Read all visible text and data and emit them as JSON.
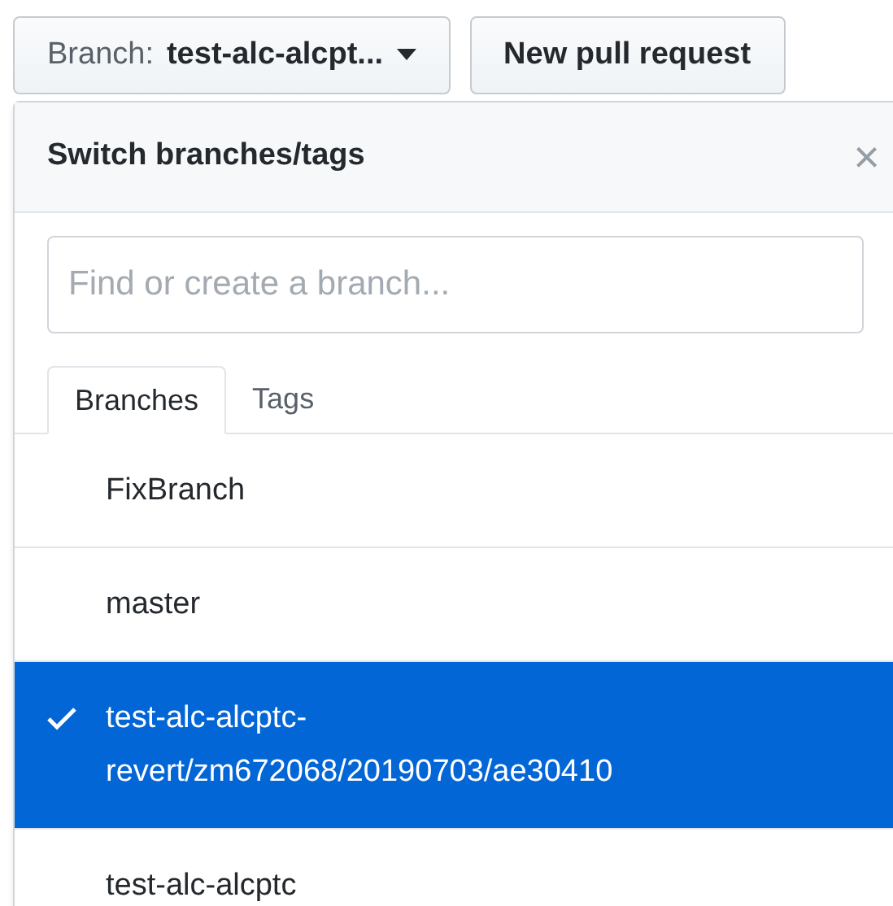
{
  "branch_button": {
    "prefix": "Branch:",
    "value": "test-alc-alcpt..."
  },
  "pull_request_button": {
    "label": "New pull request"
  },
  "dropdown": {
    "title": "Switch branches/tags",
    "close": "×",
    "search": {
      "placeholder": "Find or create a branch..."
    },
    "tabs": [
      {
        "label": "Branches",
        "selected": true
      },
      {
        "label": "Tags",
        "selected": false
      }
    ],
    "branches": [
      {
        "name": "FixBranch",
        "selected": false
      },
      {
        "name": "master",
        "selected": false
      },
      {
        "name": "test-alc-alcptc-revert/zm672068/20190703/ae30410",
        "selected": true
      },
      {
        "name": "test-alc-alcptc",
        "selected": false
      }
    ]
  }
}
